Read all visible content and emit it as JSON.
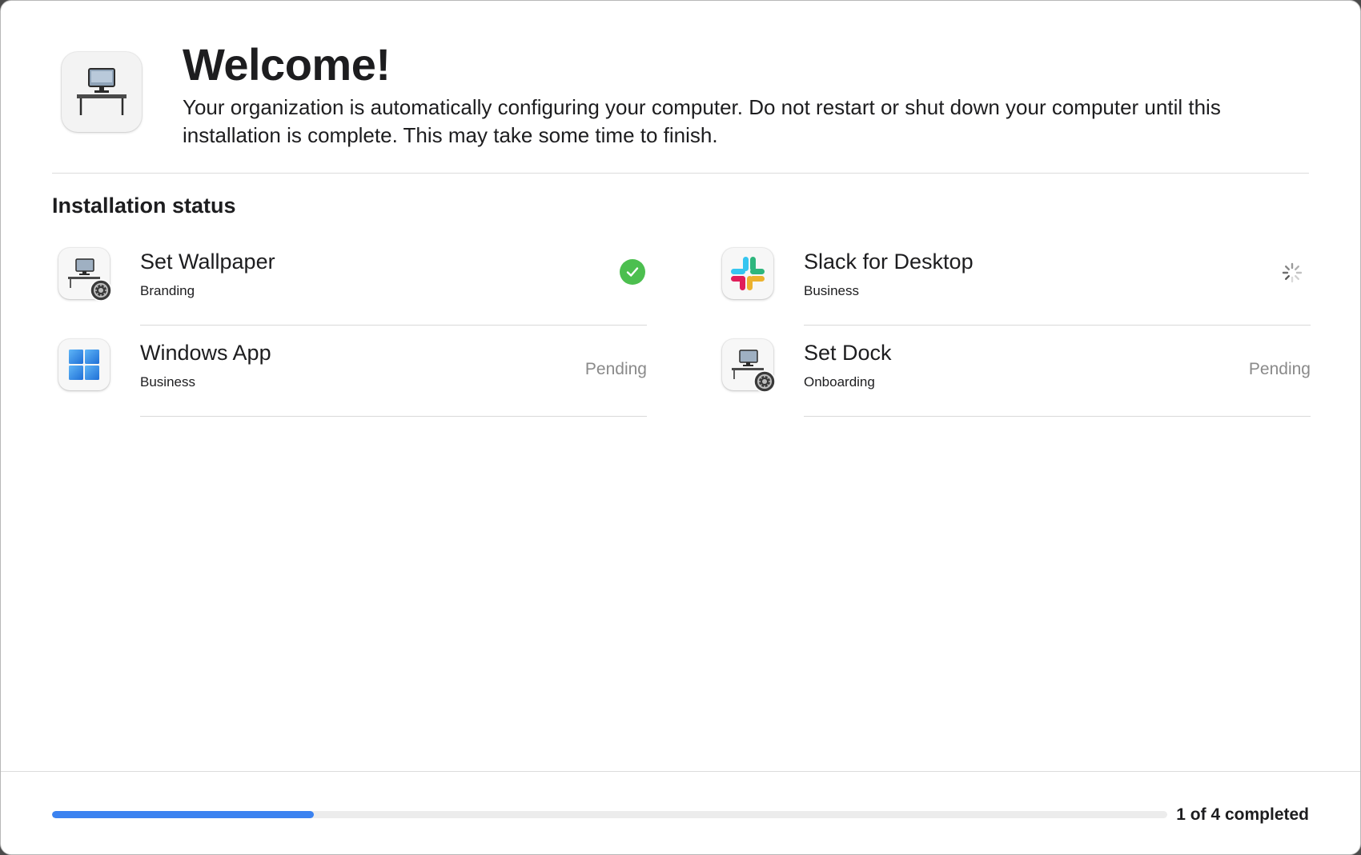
{
  "header": {
    "title": "Welcome!",
    "description": "Your organization is automatically configuring your computer. Do not restart or shut down your computer until this installation is complete. This may take some time to finish.",
    "icon": "computer-desk-icon"
  },
  "section": {
    "title": "Installation status"
  },
  "items": [
    {
      "name": "Set Wallpaper",
      "category": "Branding",
      "status": "completed",
      "status_label": "",
      "icon": "computer-settings-icon"
    },
    {
      "name": "Slack for Desktop",
      "category": "Business",
      "status": "installing",
      "status_label": "",
      "icon": "slack-icon"
    },
    {
      "name": "Windows App",
      "category": "Business",
      "status": "pending",
      "status_label": "Pending",
      "icon": "windows-icon"
    },
    {
      "name": "Set Dock",
      "category": "Onboarding",
      "status": "pending",
      "status_label": "Pending",
      "icon": "computer-settings-icon"
    }
  ],
  "progress": {
    "completed": 1,
    "total": 4,
    "fraction": 0.235,
    "label": "1 of 4 completed"
  },
  "colors": {
    "accent": "#3b82f0",
    "success": "#4cbf4f",
    "pending_text": "#8a8a8a"
  }
}
